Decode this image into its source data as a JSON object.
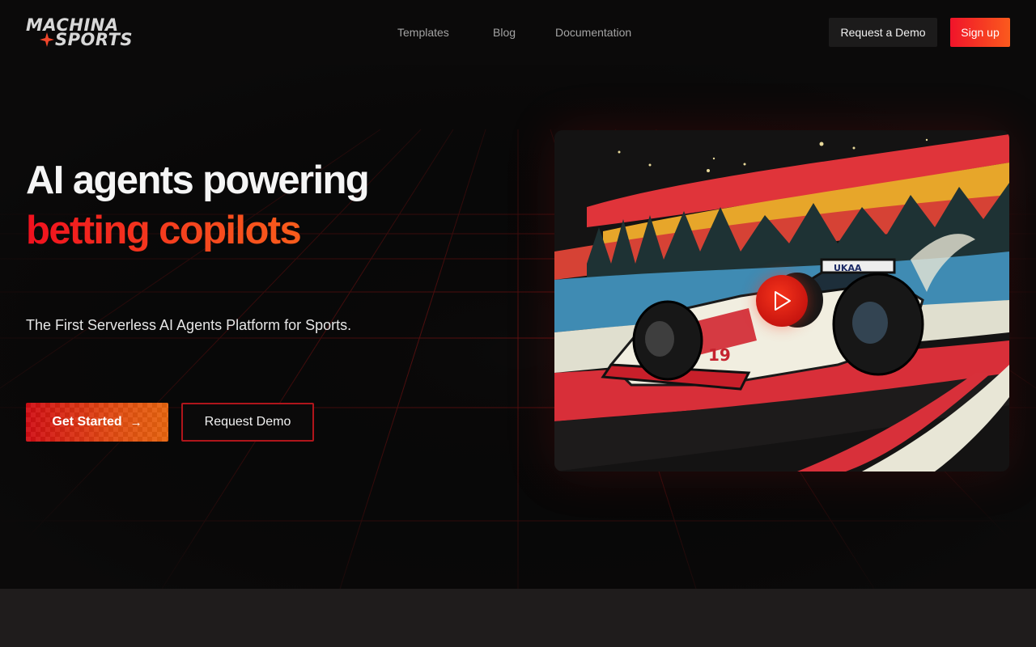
{
  "brand": {
    "name_line1": "MACHINA",
    "name_line2": "SPORTS",
    "accent_color": "#f0142a"
  },
  "nav": {
    "items": [
      "Templates",
      "Blog",
      "Documentation"
    ]
  },
  "header_actions": {
    "request_demo": "Request a Demo",
    "sign_up": "Sign up"
  },
  "hero": {
    "title_line1": "AI agents powering",
    "title_line2": "betting copilots",
    "subtitle": "The First Serverless AI Agents Platform for Sports.",
    "primary_cta": "Get Started",
    "primary_cta_icon": "arrow-right-icon",
    "secondary_cta": "Request Demo"
  },
  "video": {
    "play_icon": "play-icon",
    "car_number": "19",
    "car_livery_text": "UKAA"
  }
}
